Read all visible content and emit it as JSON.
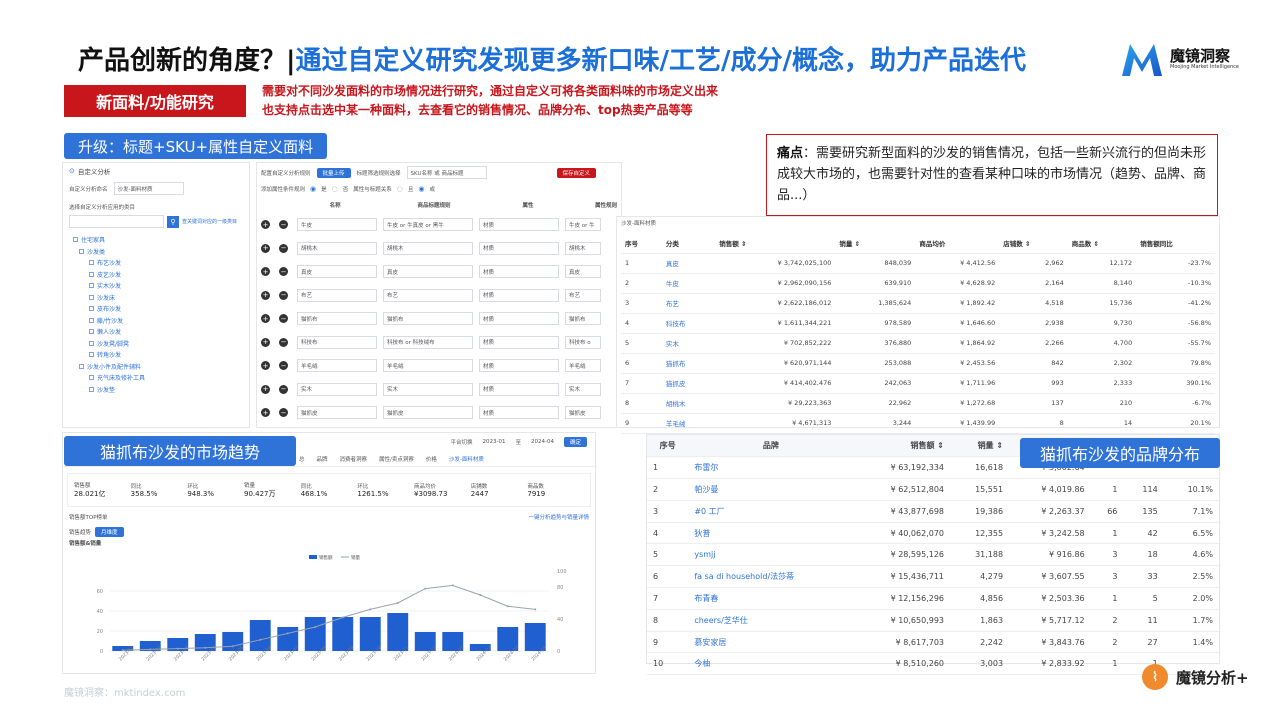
{
  "header": {
    "title_prefix": "产品创新的角度？|",
    "title_highlight": "通过自定义研究发现更多新口味/工艺/成分/概念，助力产品迭代",
    "logo_cn": "魔镜洞察",
    "logo_en": "Moojing Market Intelligence"
  },
  "tag": "新面料/功能研究",
  "intro": [
    "需要对不同沙发面料的市场情况进行研究，通过自定义可将各类面料味的市场定义出来",
    "也支持点击选中某一种面料，去查看它的销售情况、品牌分布、top热卖产品等等"
  ],
  "section_upgrade": "升级：标题+SKU+属性自定义面料",
  "pain": {
    "label": "痛点",
    "text": "：需要研究新型面料的沙发的销售情况，包括一些新兴流行的但尚未形成较大市场的，也需要针对性的查看某种口味的市场情况（趋势、品牌、商品...）"
  },
  "config": {
    "title": "自定义分析",
    "name_label": "自定义分析命名",
    "name_value": "沙发-面料材质",
    "category_label": "选择自定义分析应用的类目",
    "search_hint": "查关键词对应的一级类目",
    "tree": [
      "住宅家具",
      "沙发类",
      "布艺沙发",
      "皮艺沙发",
      "实木沙发",
      "沙发床",
      "皮布沙发",
      "藤/竹沙发",
      "懒人沙发",
      "沙发凳/脚凳",
      "转角沙发",
      "沙发小件及配件辅料",
      "充气床及修补工具",
      "沙发垫"
    ],
    "rule_label": "配置自定义分析规则",
    "batch_button": "批量上传",
    "title_rule_label": "标题筛选规则选择",
    "title_rule_value": "SKU名称 或 商品标题",
    "save_button": "保存自定义",
    "add_attr_label": "添加属性条件规则",
    "yes": "是",
    "no": "否",
    "relation_label": "属性与标题关系",
    "and": "且",
    "or": "或",
    "col_name": "名称",
    "col_title": "商品标题规则",
    "col_attr": "属性",
    "col_attr_rule": "属性规则",
    "rows": [
      {
        "name": "牛皮",
        "title": "牛皮 or 牛真皮 or 黑牛",
        "attr": "材质",
        "rule": "牛皮 or 牛"
      },
      {
        "name": "胡桃木",
        "title": "胡桃木",
        "attr": "材质",
        "rule": "胡桃木"
      },
      {
        "name": "真皮",
        "title": "真皮",
        "attr": "材质",
        "rule": "真皮"
      },
      {
        "name": "布艺",
        "title": "布艺",
        "attr": "材质",
        "rule": "布艺"
      },
      {
        "name": "猫抓布",
        "title": "猫抓布",
        "attr": "材质",
        "rule": "猫抓布"
      },
      {
        "name": "科技布",
        "title": "科技布 or 科技绒布",
        "attr": "材质",
        "rule": "科技布 o"
      },
      {
        "name": "羊毛绒",
        "title": "羊毛绒",
        "attr": "材质",
        "rule": "羊毛绒"
      },
      {
        "name": "实木",
        "title": "实木",
        "attr": "材质",
        "rule": "实木"
      },
      {
        "name": "猫抓皮",
        "title": "猫抓皮",
        "attr": "材质",
        "rule": "猫抓皮"
      }
    ]
  },
  "results": {
    "title": "沙发-面料材质",
    "headers": [
      "序号",
      "分类",
      "销售额 ⇕",
      "销量 ⇕",
      "商品均价",
      "店铺数 ⇕",
      "商品数 ⇕",
      "销售额同比"
    ],
    "rows": [
      [
        "1",
        "真皮",
        "¥ 3,742,025,100",
        "848,039",
        "¥ 4,412.56",
        "2,962",
        "12,172",
        "-23.7%"
      ],
      [
        "2",
        "牛皮",
        "¥ 2,962,090,156",
        "639,910",
        "¥ 4,628.92",
        "2,164",
        "8,140",
        "-10.3%"
      ],
      [
        "3",
        "布艺",
        "¥ 2,622,186,012",
        "1,385,624",
        "¥ 1,892.42",
        "4,518",
        "15,736",
        "-41.2%"
      ],
      [
        "4",
        "科技布",
        "¥ 1,611,344,221",
        "978,589",
        "¥ 1,646.60",
        "2,938",
        "9,730",
        "-56.8%"
      ],
      [
        "5",
        "实木",
        "¥ 702,852,222",
        "376,880",
        "¥ 1,864.92",
        "2,266",
        "4,700",
        "-55.7%"
      ],
      [
        "6",
        "猫抓布",
        "¥ 620,971,144",
        "253,088",
        "¥ 2,453.56",
        "842",
        "2,302",
        "79.8%"
      ],
      [
        "7",
        "猫抓皮",
        "¥ 414,402,476",
        "242,063",
        "¥ 1,711.96",
        "993",
        "2,333",
        "390.1%"
      ],
      [
        "8",
        "胡桃木",
        "¥ 29,223,363",
        "22,962",
        "¥ 1,272.68",
        "137",
        "210",
        "-6.7%"
      ],
      [
        "9",
        "羊毛绒",
        "¥ 4,671,313",
        "3,244",
        "¥ 1,439.99",
        "8",
        "14",
        "20.1%"
      ]
    ]
  },
  "trend": {
    "label": "猫抓布沙发的市场趋势",
    "top_platform": "平台切换",
    "date_from": "2023-01",
    "date_to": "2024-04",
    "confirm": "确定",
    "tabs": [
      "总",
      "品牌",
      "消费者洞察",
      "属性/卖点洞察",
      "价格"
    ],
    "filter_tag": "沙发-面料材质",
    "kpis": [
      {
        "label": "销售额",
        "value": "28.021亿"
      },
      {
        "label": "同比",
        "value": "358.5%"
      },
      {
        "label": "环比",
        "value": "948.3%"
      },
      {
        "label": "销量",
        "value": "90.427万"
      },
      {
        "label": "同比",
        "value": "468.1%"
      },
      {
        "label": "环比",
        "value": "1261.5%"
      },
      {
        "label": "商品均价",
        "value": "¥3098.73"
      },
      {
        "label": "店铺数",
        "value": "2447"
      },
      {
        "label": "商品数",
        "value": "7919"
      }
    ],
    "top_list": "销售额TOP榜单",
    "right_link": "一键分析趋势与销量详情",
    "chart_section": "销售趋势",
    "chart_badge": "月维度",
    "chart_title": "销售额&销量"
  },
  "brand": {
    "label": "猫抓布沙发的品牌分布",
    "headers": [
      "序号",
      "品牌",
      "销售额 ⇕",
      "销量 ⇕",
      "商品均价",
      "",
      "",
      ""
    ],
    "rows": [
      [
        "1",
        "布雷尔",
        "¥ 63,192,334",
        "16,618",
        "¥ 3,802.64",
        "",
        "",
        ""
      ],
      [
        "2",
        "帕沙曼",
        "¥ 62,512,804",
        "15,551",
        "¥ 4,019.86",
        "1",
        "114",
        "10.1%"
      ],
      [
        "3",
        "#0 工厂",
        "¥ 43,877,698",
        "19,386",
        "¥ 2,263.37",
        "66",
        "135",
        "7.1%"
      ],
      [
        "4",
        "狄普",
        "¥ 40,062,070",
        "12,355",
        "¥ 3,242.58",
        "1",
        "42",
        "6.5%"
      ],
      [
        "5",
        "ysmjj",
        "¥ 28,595,126",
        "31,188",
        "¥ 916.86",
        "3",
        "18",
        "4.6%"
      ],
      [
        "6",
        "fa sa di household/法莎蒂",
        "¥ 15,436,711",
        "4,279",
        "¥ 3,607.55",
        "3",
        "33",
        "2.5%"
      ],
      [
        "7",
        "布青春",
        "¥ 12,156,296",
        "4,856",
        "¥ 2,503.36",
        "1",
        "5",
        "2.0%"
      ],
      [
        "8",
        "cheers/芝华仕",
        "¥ 10,650,993",
        "1,863",
        "¥ 5,717.12",
        "2",
        "11",
        "1.7%"
      ],
      [
        "9",
        "慕安家居",
        "¥ 8,617,703",
        "2,242",
        "¥ 3,843.76",
        "2",
        "27",
        "1.4%"
      ],
      [
        "10",
        "今柚",
        "¥ 8,510,260",
        "3,003",
        "¥ 2,833.92",
        "1",
        "1",
        ""
      ]
    ]
  },
  "footer": "魔镜洞察：mktindex.com",
  "brand_logo": "魔镜分析+",
  "chart_data": {
    "type": "bar",
    "title": "销售额&销量",
    "legend": [
      "销售额",
      "销量"
    ],
    "categories": [
      "2023-01",
      "2023-02",
      "2023-03",
      "2023-04",
      "2023-05",
      "2023-06",
      "2023-07",
      "2023-08",
      "2023-09",
      "2023-10",
      "2023-11",
      "2023-12",
      "2024-01",
      "2024-02",
      "2024-03",
      "2024-04"
    ],
    "bar_values": [
      5,
      10,
      13,
      17,
      19,
      31,
      24,
      34,
      34,
      34,
      38,
      19,
      19,
      7,
      24,
      28
    ],
    "line_values": [
      1,
      2,
      3,
      4,
      6,
      14,
      22,
      30,
      42,
      52,
      60,
      78,
      82,
      70,
      56,
      52
    ],
    "ylim_left": [
      0,
      80
    ],
    "ylim_right": [
      0,
      100
    ],
    "left_ticks": [
      "0",
      "20",
      "40",
      "60"
    ],
    "right_ticks": [
      "0",
      "40",
      "80",
      "100"
    ]
  }
}
